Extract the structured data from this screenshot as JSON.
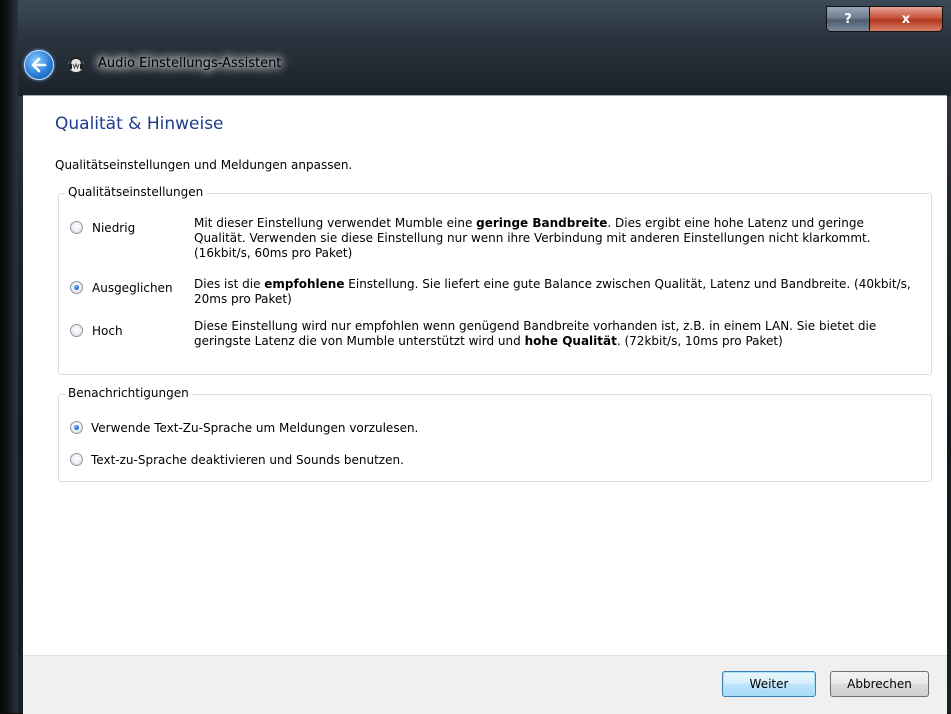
{
  "window": {
    "title": "Audio Einstellungs-Assistent",
    "help_label": "?",
    "close_label": "x"
  },
  "page": {
    "title": "Qualität & Hinweise",
    "subtitle": "Qualitätseinstellungen und Meldungen anpassen."
  },
  "quality": {
    "legend": "Qualitätseinstellungen",
    "options": [
      {
        "label": "Niedrig",
        "checked": false,
        "desc_pre": "Mit dieser Einstellung verwendet Mumble eine ",
        "desc_bold": "geringe Bandbreite",
        "desc_post": ". Dies ergibt eine hohe Latenz und geringe Qualität. Verwenden sie diese Einstellung nur wenn ihre Verbindung mit anderen Einstellungen nicht klarkommt. (16kbit/s, 60ms pro Paket)"
      },
      {
        "label": "Ausgeglichen",
        "checked": true,
        "desc_pre": "Dies ist die ",
        "desc_bold": "empfohlene",
        "desc_post": " Einstellung. Sie liefert eine gute Balance zwischen Qualität, Latenz und Bandbreite. (40kbit/s, 20ms pro Paket)"
      },
      {
        "label": "Hoch",
        "checked": false,
        "desc_pre": "Diese Einstellung wird nur empfohlen wenn genügend Bandbreite vorhanden ist, z.B. in einem LAN. Sie bietet die geringste Latenz die von Mumble unterstützt wird und ",
        "desc_bold": "hohe Qualität",
        "desc_post": ". (72kbit/s, 10ms pro Paket)"
      }
    ]
  },
  "notifications": {
    "legend": "Benachrichtigungen",
    "options": [
      {
        "label": "Verwende Text-Zu-Sprache um Meldungen vorzulesen.",
        "checked": true
      },
      {
        "label": "Text-zu-Sprache deaktivieren und Sounds benutzen.",
        "checked": false
      }
    ]
  },
  "buttons": {
    "next": "Weiter",
    "cancel": "Abbrechen"
  },
  "icons": {
    "back": "back-arrow-icon",
    "app": "mumble-icon"
  }
}
